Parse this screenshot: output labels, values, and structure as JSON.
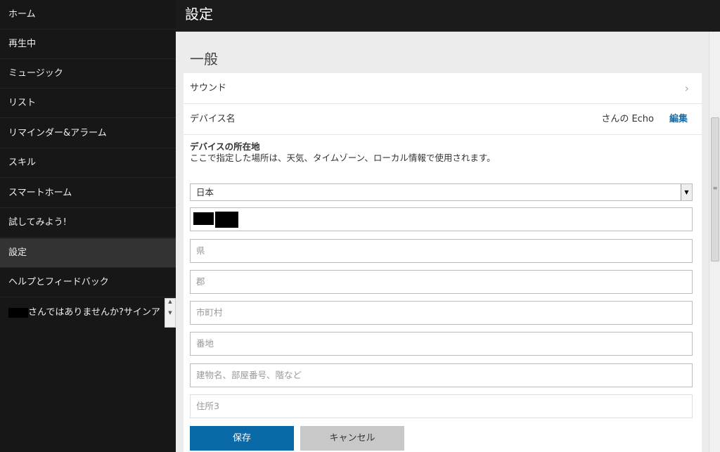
{
  "sidebar": {
    "items": [
      {
        "label": "ホーム"
      },
      {
        "label": "再生中"
      },
      {
        "label": "ミュージック"
      },
      {
        "label": "リスト"
      },
      {
        "label": "リマインダー&アラーム"
      },
      {
        "label": "スキル"
      },
      {
        "label": "スマートホーム"
      },
      {
        "label": "試してみよう!"
      },
      {
        "label": "設定",
        "selected": true
      },
      {
        "label": "ヘルプとフィードバック"
      },
      {
        "label": "さんではありませんか?サインア"
      }
    ]
  },
  "header": {
    "title": "設定"
  },
  "section": {
    "title": "一般",
    "sound": "サウンド",
    "device_name_label": "デバイス名",
    "device_name_value": "さんの Echo",
    "edit": "編集",
    "location_title": "デバイスの所在地",
    "location_desc": "ここで指定した場所は、天気、タイムゾーン、ローカル情報で使用されます。",
    "country": "日本",
    "placeholders": {
      "prefecture": "県",
      "county": "郡",
      "city": "市町村",
      "street": "番地",
      "building": "建物名、部屋番号、階など",
      "address3": "住所3"
    },
    "save": "保存",
    "cancel": "キャンセル"
  },
  "colors": {
    "accent": "#0a6aa8",
    "sidebar": "#171717"
  }
}
